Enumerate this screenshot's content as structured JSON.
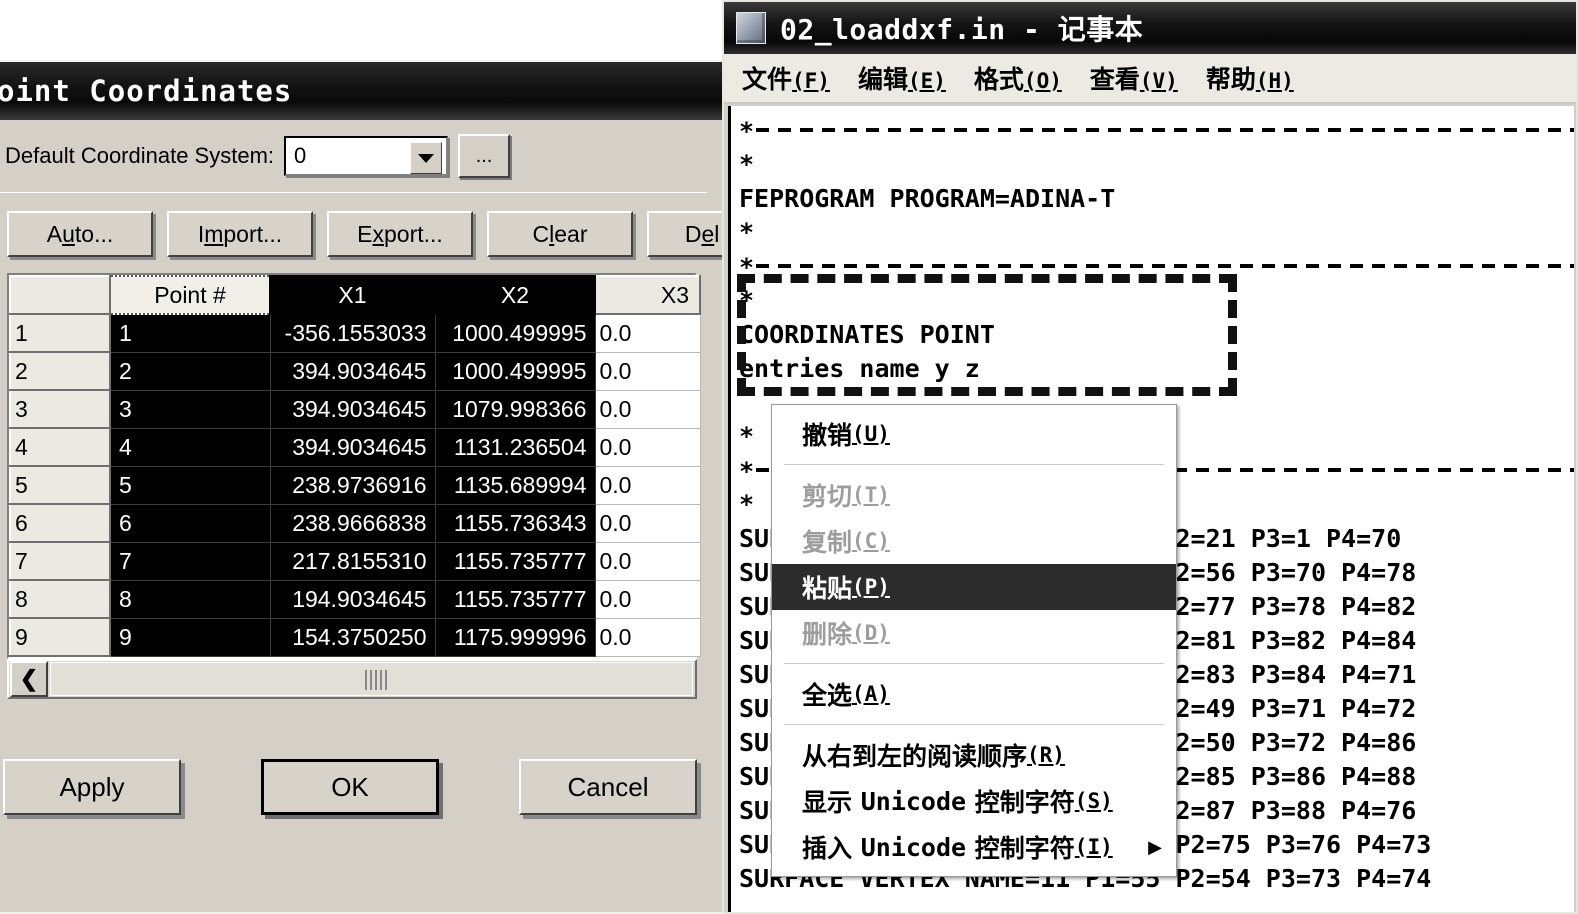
{
  "dialog": {
    "title": "oint Coordinates",
    "coord_system_label": "Default Coordinate System:",
    "coord_system_value": "0",
    "ellipsis_label": "...",
    "toolbar": [
      {
        "pre": "A",
        "acc": "u",
        "post": "to..."
      },
      {
        "pre": "I",
        "acc": "m",
        "post": "port..."
      },
      {
        "pre": "E",
        "acc": "x",
        "post": "port..."
      },
      {
        "pre": "C",
        "acc": "l",
        "post": "ear"
      },
      {
        "pre": "D",
        "acc": "e",
        "post": "l Ro"
      }
    ],
    "grid": {
      "headers": [
        "",
        "Point #",
        "X1",
        "X2",
        "X3"
      ],
      "rows": [
        {
          "n": "1",
          "point": "1",
          "x1": "-356.1553033",
          "x2": "1000.499995",
          "x3": "0.0"
        },
        {
          "n": "2",
          "point": "2",
          "x1": "394.9034645",
          "x2": "1000.499995",
          "x3": "0.0"
        },
        {
          "n": "3",
          "point": "3",
          "x1": "394.9034645",
          "x2": "1079.998366",
          "x3": "0.0"
        },
        {
          "n": "4",
          "point": "4",
          "x1": "394.9034645",
          "x2": "1131.236504",
          "x3": "0.0"
        },
        {
          "n": "5",
          "point": "5",
          "x1": "238.9736916",
          "x2": "1135.689994",
          "x3": "0.0"
        },
        {
          "n": "6",
          "point": "6",
          "x1": "238.9666838",
          "x2": "1155.736343",
          "x3": "0.0"
        },
        {
          "n": "7",
          "point": "7",
          "x1": "217.8155310",
          "x2": "1155.735777",
          "x3": "0.0"
        },
        {
          "n": "8",
          "point": "8",
          "x1": "194.9034645",
          "x2": "1155.735777",
          "x3": "0.0"
        },
        {
          "n": "9",
          "point": "9",
          "x1": "154.3750250",
          "x2": "1175.999996",
          "x3": "0.0"
        }
      ]
    },
    "scroll_left_icon": "❮",
    "buttons": {
      "apply": "Apply",
      "ok": "OK",
      "cancel": "Cancel"
    }
  },
  "notepad": {
    "title": "02_loaddxf.in - 记事本",
    "menus": [
      {
        "label": "文件",
        "acc": "F"
      },
      {
        "label": "编辑",
        "acc": "E"
      },
      {
        "label": "格式",
        "acc": "O"
      },
      {
        "label": "查看",
        "acc": "V"
      },
      {
        "label": "帮助",
        "acc": "H"
      }
    ],
    "text_lines": [
      {
        "type": "dashrule",
        "text": "*"
      },
      {
        "type": "plain",
        "text": "*"
      },
      {
        "type": "plain",
        "text": "FEPROGRAM PROGRAM=ADINA-T"
      },
      {
        "type": "plain",
        "text": "*"
      },
      {
        "type": "dashrule",
        "text": "*"
      },
      {
        "type": "plain",
        "text": "*"
      },
      {
        "type": "plain",
        "text": "COORDINATES POINT"
      },
      {
        "type": "plain",
        "text": "entries name y z"
      },
      {
        "type": "plain",
        "text": ""
      },
      {
        "type": "plain",
        "text": "*"
      },
      {
        "type": "dashrule",
        "text": "*"
      },
      {
        "type": "plain",
        "text": "*"
      },
      {
        "type": "plain",
        "text": "SURFACE VERTEX NAME=1 P1=56 P2=21 P3=1 P4=70"
      },
      {
        "type": "plain",
        "text": "SURFACE VERTEX NAME=2 P1=77 P2=56 P3=70 P4=78"
      },
      {
        "type": "plain",
        "text": "SURFACE VERTEX NAME=3 P1=81 P2=77 P3=78 P4=82"
      },
      {
        "type": "plain",
        "text": "SURFACE VERTEX NAME=4 P1=83 P2=81 P3=82 P4=84"
      },
      {
        "type": "plain",
        "text": "SURFACE VERTEX NAME=5 P1=49 P2=83 P3=84 P4=71"
      },
      {
        "type": "plain",
        "text": "SURFACE VERTEX NAME=6 P1=50 P2=49 P3=71 P4=72"
      },
      {
        "type": "plain",
        "text": "SURFACE VERTEX NAME=7 P1=85 P2=50 P3=72 P4=86"
      },
      {
        "type": "plain",
        "text": "SURFACE VERTEX NAME=8 P1=87 P2=85 P3=86 P4=88"
      },
      {
        "type": "plain",
        "text": "SURFACE VERTEX NAME=9 P1=75 P2=87 P3=88 P4=76"
      },
      {
        "type": "plain",
        "text": "SURFACE VERTEX NAME=10 P1=54 P2=75 P3=76 P4=73"
      },
      {
        "type": "plain",
        "text": "SURFACE VERTEX NAME=11 P1=55 P2=54 P3=73 P4=74"
      }
    ],
    "context_menu": [
      {
        "label": "撤销",
        "acc": "U",
        "state": "normal"
      },
      {
        "type": "separator"
      },
      {
        "label": "剪切",
        "acc": "T",
        "state": "disabled"
      },
      {
        "label": "复制",
        "acc": "C",
        "state": "disabled"
      },
      {
        "label": "粘贴",
        "acc": "P",
        "state": "highlight"
      },
      {
        "label": "删除",
        "acc": "D",
        "state": "disabled"
      },
      {
        "type": "separator"
      },
      {
        "label": "全选",
        "acc": "A",
        "state": "normal"
      },
      {
        "type": "separator"
      },
      {
        "label": "从右到左的阅读顺序",
        "acc": "R",
        "state": "normal"
      },
      {
        "label": "显示 Unicode 控制字符",
        "acc": "S",
        "state": "normal",
        "mono_part": "Unicode"
      },
      {
        "label": "插入 Unicode 控制字符",
        "acc": "I",
        "state": "normal",
        "submenu": true,
        "mono_part": "Unicode"
      }
    ],
    "submenu_arrow": "▶"
  },
  "colors": {
    "dialog_face": "#d4d0c8",
    "title_dark": "#0a0a0a",
    "grid_selected": "#000000",
    "menu_highlight": "#2c2c2c"
  }
}
